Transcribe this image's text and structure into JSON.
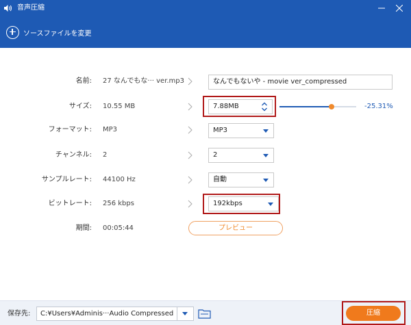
{
  "window": {
    "title": "音声圧縮",
    "minimize_label": "—",
    "close_label": "✕"
  },
  "toolbar": {
    "add_source_label": "ソースファイルを変更"
  },
  "rows": {
    "name": {
      "label": "名前:",
      "value": "27 なんでもな··· ver.mp3",
      "output": "なんでもないや - movie ver_compressed"
    },
    "size": {
      "label": "サイズ:",
      "value": "10.55 MB",
      "output": "7.88MB",
      "slider_fraction": 0.68,
      "percent": "-25.31%"
    },
    "format": {
      "label": "フォーマット:",
      "value": "MP3",
      "output": "MP3"
    },
    "channel": {
      "label": "チャンネル:",
      "value": "2",
      "output": "2"
    },
    "sample_rate": {
      "label": "サンプルレート:",
      "value": "44100 Hz",
      "output": "自動"
    },
    "bitrate": {
      "label": "ビットレート:",
      "value": "256 kbps",
      "output": "192kbps"
    },
    "duration": {
      "label": "期間:",
      "value": "00:05:44"
    }
  },
  "preview_label": "プレビュー",
  "footer": {
    "save_label": "保存先:",
    "path": "C:¥Users¥Adminis···Audio Compressed",
    "compress_label": "圧縮"
  },
  "colors": {
    "brand_blue": "#1e5ab4",
    "accent_orange": "#f07a1c",
    "highlight_red": "#b01818"
  },
  "icons": {
    "app": "speaker-icon",
    "add": "plus-circle-icon",
    "chevron": "chevron-right-icon",
    "dropdown": "caret-down-icon",
    "folder": "folder-icon"
  }
}
